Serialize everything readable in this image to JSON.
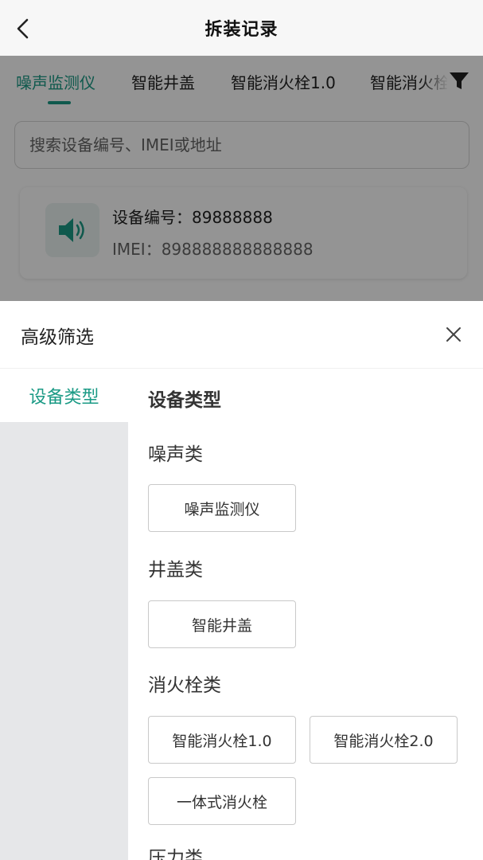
{
  "nav": {
    "title": "拆装记录"
  },
  "tabs": [
    {
      "label": "噪声监测仪",
      "active": true
    },
    {
      "label": "智能井盖"
    },
    {
      "label": "智能消火栓1.0"
    },
    {
      "label": "智能消火栓"
    }
  ],
  "search": {
    "placeholder": "搜索设备编号、IMEI或地址"
  },
  "device_card": {
    "number_line": "设备编号：89888888",
    "imei_line": "IMEI：898888888888888",
    "icon": "speaker-icon"
  },
  "filter_panel": {
    "title": "高级筛选",
    "sidebar": [
      {
        "label": "设备类型",
        "active": true
      }
    ],
    "section_title": "设备类型",
    "groups": [
      {
        "title": "噪声类",
        "options": [
          "噪声监测仪"
        ]
      },
      {
        "title": "井盖类",
        "options": [
          "智能井盖"
        ]
      },
      {
        "title": "消火栓类",
        "options": [
          "智能消火栓1.0",
          "智能消火栓2.0",
          "一体式消火栓"
        ]
      },
      {
        "title": "压力类",
        "options": []
      }
    ]
  },
  "colors": {
    "accent": "#1a9a85",
    "mask": "#000000"
  }
}
